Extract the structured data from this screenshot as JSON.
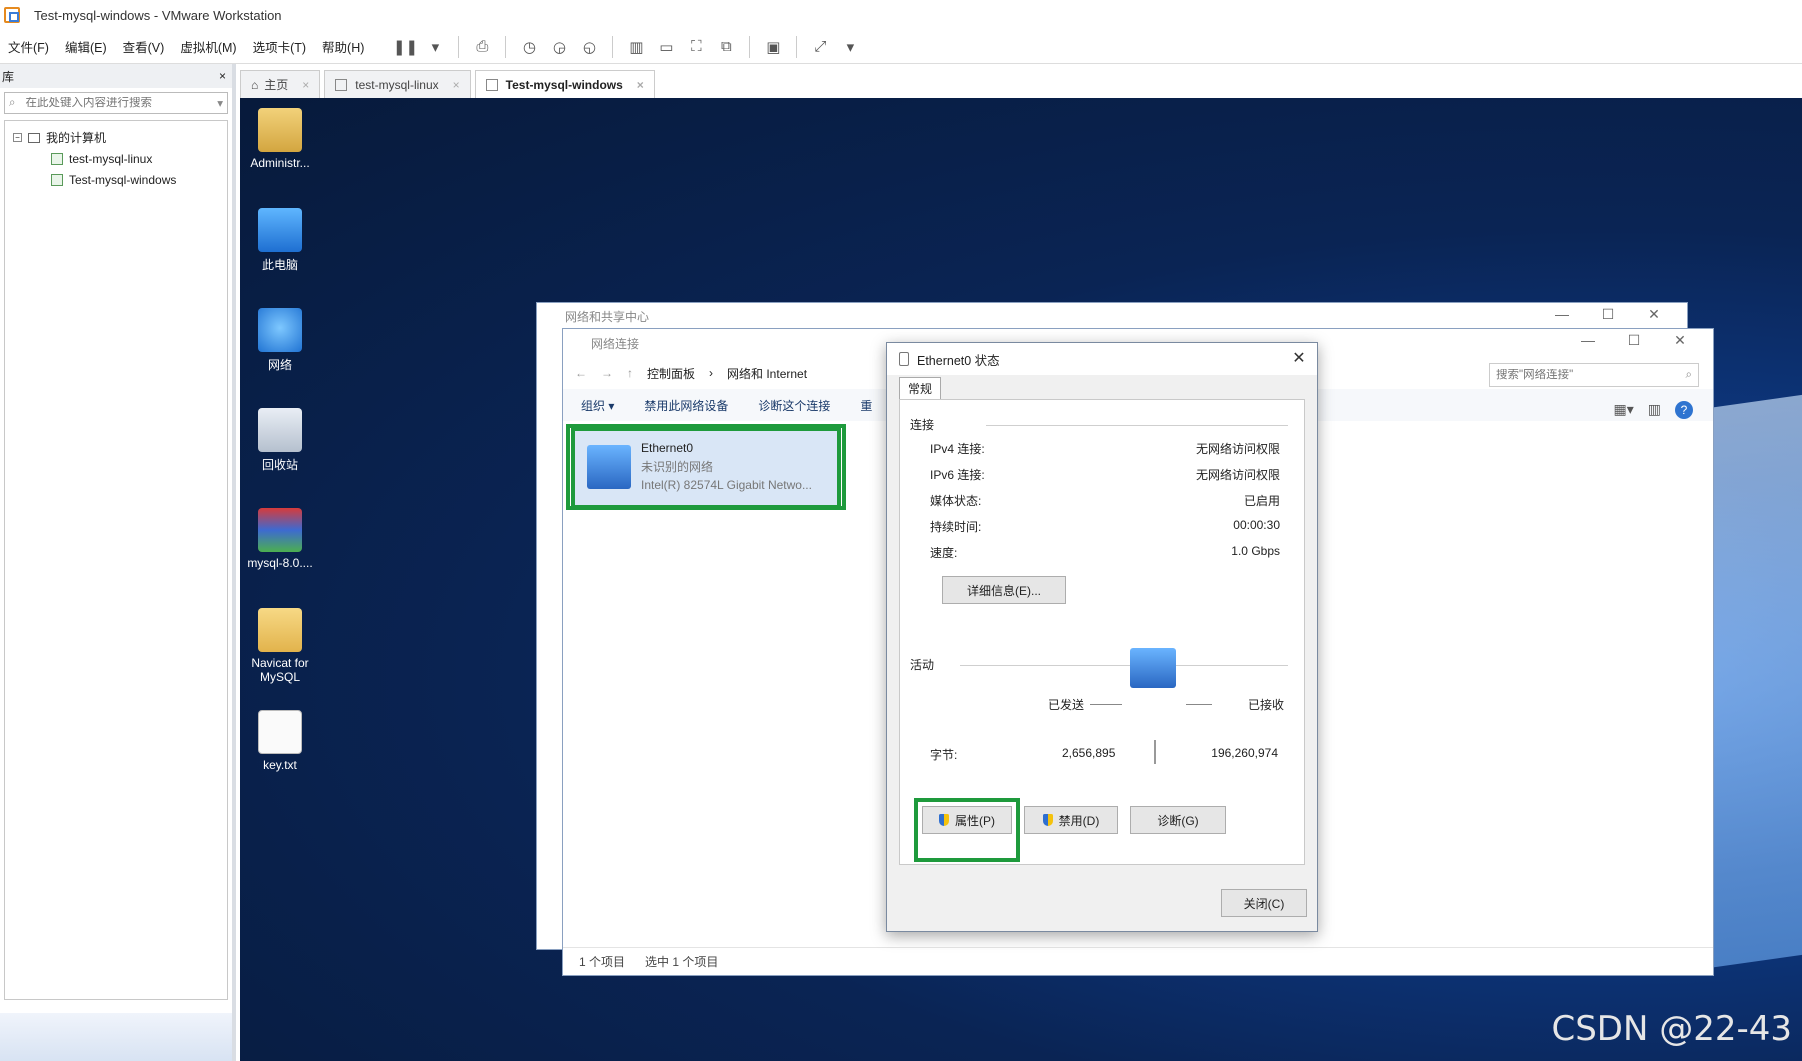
{
  "app": {
    "title": "Test-mysql-windows - VMware Workstation",
    "menu": [
      "文件(F)",
      "编辑(E)",
      "查看(V)",
      "虚拟机(M)",
      "选项卡(T)",
      "帮助(H)"
    ]
  },
  "library": {
    "header": "库",
    "close": "×",
    "search_placeholder": "在此处键入内容进行搜索",
    "tree_root": "我的计算机",
    "vms": [
      "test-mysql-linux",
      "Test-mysql-windows"
    ]
  },
  "tabs": [
    {
      "label": "主页"
    },
    {
      "label": "test-mysql-linux"
    },
    {
      "label": "Test-mysql-windows"
    }
  ],
  "desktop_icons": [
    {
      "label": "Administr...",
      "icon": "user-folder-icon"
    },
    {
      "label": "此电脑",
      "icon": "this-pc-icon"
    },
    {
      "label": "网络",
      "icon": "network-icon"
    },
    {
      "label": "回收站",
      "icon": "recycle-bin-icon"
    },
    {
      "label": "mysql-8.0....",
      "icon": "winrar-icon"
    },
    {
      "label": "Navicat for MySQL",
      "icon": "folder-icon"
    },
    {
      "label": "key.txt",
      "icon": "text-file-icon"
    }
  ],
  "nsc": {
    "title": "网络和共享中心"
  },
  "nc": {
    "title": "网络连接",
    "breadcrumb": [
      "控制面板",
      "网络和 Internet"
    ],
    "search_placeholder": "搜索\"网络连接\"",
    "commands": [
      "组织 ▾",
      "禁用此网络设备",
      "诊断这个连接",
      "重"
    ],
    "item": {
      "name": "Ethernet0",
      "status": "未识别的网络",
      "device": "Intel(R) 82574L Gigabit Netwo..."
    },
    "status_count": "1 个项目",
    "status_selected": "选中 1 个项目"
  },
  "dialog": {
    "title": "Ethernet0 状态",
    "tab": "常规",
    "connection_group": "连接",
    "rows": [
      {
        "label": "IPv4 连接:",
        "value": "无网络访问权限"
      },
      {
        "label": "IPv6 连接:",
        "value": "无网络访问权限"
      },
      {
        "label": "媒体状态:",
        "value": "已启用"
      },
      {
        "label": "持续时间:",
        "value": "00:00:30"
      },
      {
        "label": "速度:",
        "value": "1.0 Gbps"
      }
    ],
    "details_button": "详细信息(E)...",
    "activity_group": "活动",
    "sent_label": "已发送",
    "received_label": "已接收",
    "bytes_label": "字节:",
    "bytes_sent": "2,656,895",
    "bytes_received": "196,260,974",
    "properties_button": "属性(P)",
    "disable_button": "禁用(D)",
    "diagnose_button": "诊断(G)",
    "close_button": "关闭(C)"
  },
  "watermark": "CSDN @22-43",
  "colors": {
    "highlight": "#1e9a3c",
    "accent": "#2f74d0"
  }
}
